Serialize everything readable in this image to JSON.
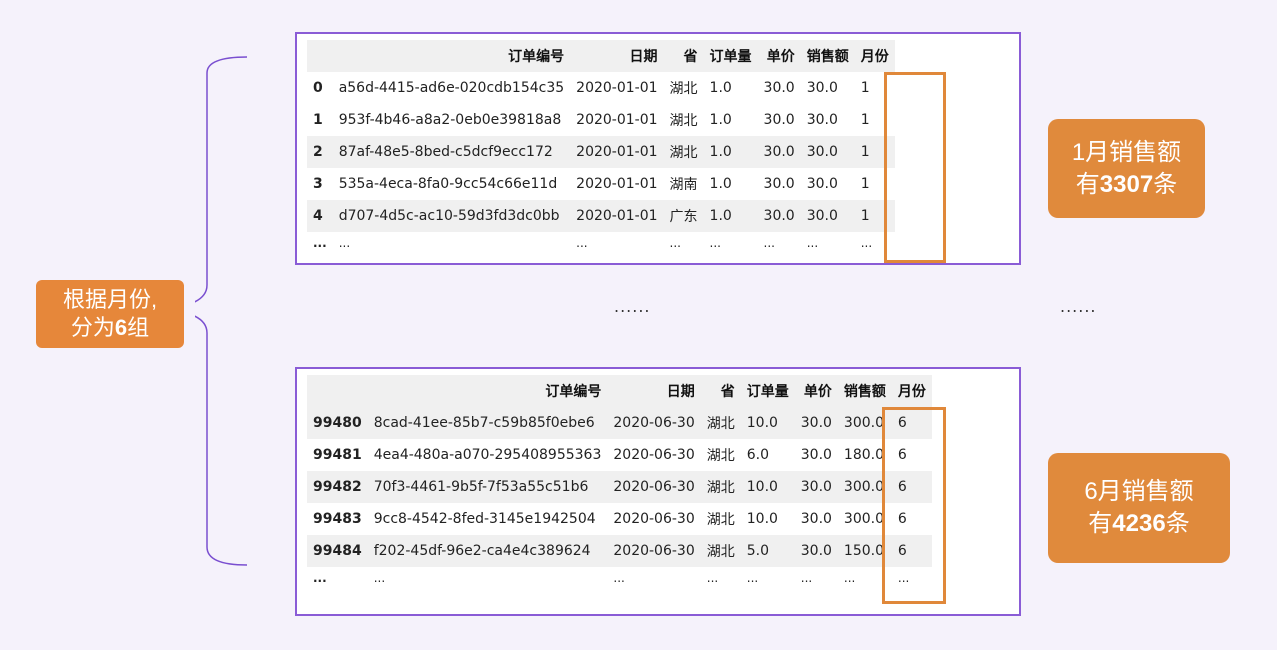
{
  "columns": [
    "订单编号",
    "日期",
    "省",
    "订单量",
    "单价",
    "销售额",
    "月份"
  ],
  "top_table": {
    "rows": [
      {
        "idx": "0",
        "order_id": "a56d-4415-ad6e-020cdb154c35",
        "date": "2020-01-01",
        "province": "湖北",
        "qty": "1.0",
        "price": "30.0",
        "sales": "30.0",
        "month": "1"
      },
      {
        "idx": "1",
        "order_id": "953f-4b46-a8a2-0eb0e39818a8",
        "date": "2020-01-01",
        "province": "湖北",
        "qty": "1.0",
        "price": "30.0",
        "sales": "30.0",
        "month": "1"
      },
      {
        "idx": "2",
        "order_id": "87af-48e5-8bed-c5dcf9ecc172",
        "date": "2020-01-01",
        "province": "湖北",
        "qty": "1.0",
        "price": "30.0",
        "sales": "30.0",
        "month": "1"
      },
      {
        "idx": "3",
        "order_id": "535a-4eca-8fa0-9cc54c66e11d",
        "date": "2020-01-01",
        "province": "湖南",
        "qty": "1.0",
        "price": "30.0",
        "sales": "30.0",
        "month": "1"
      },
      {
        "idx": "4",
        "order_id": "d707-4d5c-ac10-59d3fd3dc0bb",
        "date": "2020-01-01",
        "province": "广东",
        "qty": "1.0",
        "price": "30.0",
        "sales": "30.0",
        "month": "1"
      }
    ]
  },
  "bottom_table": {
    "rows": [
      {
        "idx": "99480",
        "order_id": "8cad-41ee-85b7-c59b85f0ebe6",
        "date": "2020-06-30",
        "province": "湖北",
        "qty": "10.0",
        "price": "30.0",
        "sales": "300.0",
        "month": "6"
      },
      {
        "idx": "99481",
        "order_id": "4ea4-480a-a070-295408955363",
        "date": "2020-06-30",
        "province": "湖北",
        "qty": "6.0",
        "price": "30.0",
        "sales": "180.0",
        "month": "6"
      },
      {
        "idx": "99482",
        "order_id": "70f3-4461-9b5f-7f53a55c51b6",
        "date": "2020-06-30",
        "province": "湖北",
        "qty": "10.0",
        "price": "30.0",
        "sales": "300.0",
        "month": "6"
      },
      {
        "idx": "99483",
        "order_id": "9cc8-4542-8fed-3145e1942504",
        "date": "2020-06-30",
        "province": "湖北",
        "qty": "10.0",
        "price": "30.0",
        "sales": "300.0",
        "month": "6"
      },
      {
        "idx": "99484",
        "order_id": "f202-45df-96e2-ca4e4c389624",
        "date": "2020-06-30",
        "province": "湖北",
        "qty": "5.0",
        "price": "30.0",
        "sales": "150.0",
        "month": "6"
      }
    ]
  },
  "ellipsis": "...",
  "callouts": {
    "group": {
      "line1": "根据月份,",
      "line2_pre": "分为",
      "line2_bold": "6",
      "line2_post": "组"
    },
    "jan": {
      "line1": "1月销售额",
      "line2_pre": "有",
      "line2_bold": "3307",
      "line2_post": "条"
    },
    "jun": {
      "line1": "6月销售额",
      "line2_pre": "有",
      "line2_bold": "4236",
      "line2_post": "条"
    }
  },
  "dots": "......",
  "colors": {
    "panel_border": "#8a5cd6",
    "highlight": "#e0883a",
    "callout_bg": "#e08a3c",
    "brace": "#7a4fd0"
  }
}
